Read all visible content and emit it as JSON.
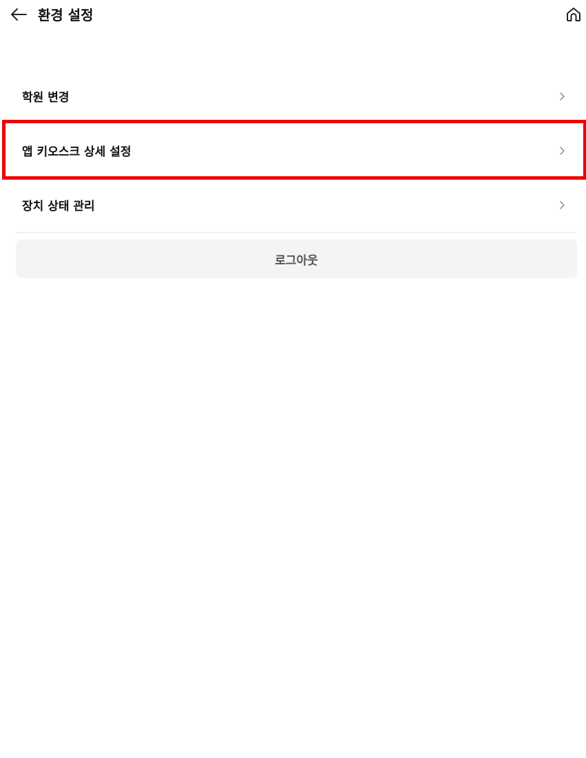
{
  "header": {
    "title": "환경 설정",
    "back_icon": "arrow-left-icon",
    "home_icon": "home-icon"
  },
  "menu": {
    "items": [
      {
        "label": "학원 변경",
        "icon": "chevron-right-icon"
      },
      {
        "label": "앱 키오스크 상세 설정",
        "icon": "chevron-right-icon"
      },
      {
        "label": "장치 상태 관리",
        "icon": "chevron-right-icon"
      }
    ]
  },
  "logout": {
    "label": "로그아웃"
  },
  "colors": {
    "highlight": "#ee0000",
    "logout_bg": "#f4f4f4",
    "divider": "#e6e6e6",
    "chevron": "#888888"
  }
}
